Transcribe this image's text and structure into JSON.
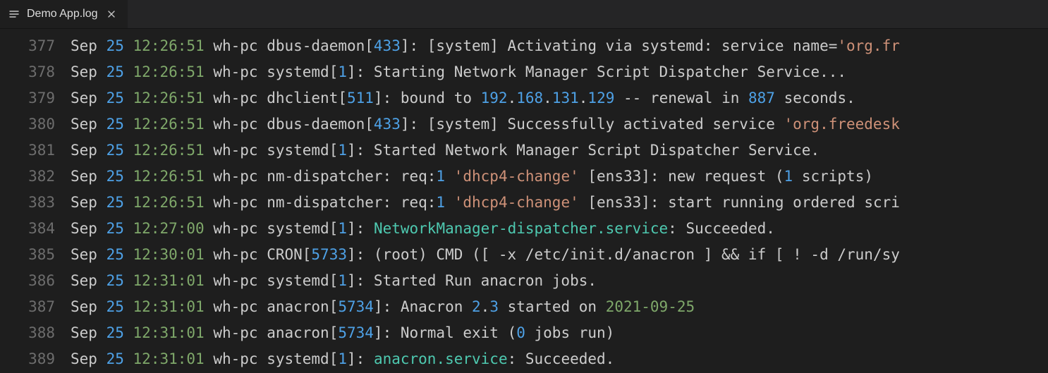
{
  "tab": {
    "title": "Demo App.log"
  },
  "lines": [
    {
      "no": 377,
      "tokens": [
        {
          "t": "Sep "
        },
        {
          "t": "25",
          "c": "blue"
        },
        {
          "t": " "
        },
        {
          "t": "12:26:51",
          "c": "green"
        },
        {
          "t": " wh-pc dbus-daemon["
        },
        {
          "t": "433",
          "c": "blue"
        },
        {
          "t": "]: [system] Activating via systemd: service name="
        },
        {
          "t": "'org.fr",
          "c": "orange"
        }
      ]
    },
    {
      "no": 378,
      "tokens": [
        {
          "t": "Sep "
        },
        {
          "t": "25",
          "c": "blue"
        },
        {
          "t": " "
        },
        {
          "t": "12:26:51",
          "c": "green"
        },
        {
          "t": " wh-pc systemd["
        },
        {
          "t": "1",
          "c": "blue"
        },
        {
          "t": "]: Starting Network Manager Script Dispatcher Service..."
        }
      ]
    },
    {
      "no": 379,
      "tokens": [
        {
          "t": "Sep "
        },
        {
          "t": "25",
          "c": "blue"
        },
        {
          "t": " "
        },
        {
          "t": "12:26:51",
          "c": "green"
        },
        {
          "t": " wh-pc dhclient["
        },
        {
          "t": "511",
          "c": "blue"
        },
        {
          "t": "]: bound to "
        },
        {
          "t": "192",
          "c": "blue"
        },
        {
          "t": "."
        },
        {
          "t": "168",
          "c": "blue"
        },
        {
          "t": "."
        },
        {
          "t": "131",
          "c": "blue"
        },
        {
          "t": "."
        },
        {
          "t": "129",
          "c": "blue"
        },
        {
          "t": " -- renewal in "
        },
        {
          "t": "887",
          "c": "blue"
        },
        {
          "t": " seconds."
        }
      ]
    },
    {
      "no": 380,
      "tokens": [
        {
          "t": "Sep "
        },
        {
          "t": "25",
          "c": "blue"
        },
        {
          "t": " "
        },
        {
          "t": "12:26:51",
          "c": "green"
        },
        {
          "t": " wh-pc dbus-daemon["
        },
        {
          "t": "433",
          "c": "blue"
        },
        {
          "t": "]: [system] Successfully activated service "
        },
        {
          "t": "'org.freedesk",
          "c": "orange"
        }
      ]
    },
    {
      "no": 381,
      "tokens": [
        {
          "t": "Sep "
        },
        {
          "t": "25",
          "c": "blue"
        },
        {
          "t": " "
        },
        {
          "t": "12:26:51",
          "c": "green"
        },
        {
          "t": " wh-pc systemd["
        },
        {
          "t": "1",
          "c": "blue"
        },
        {
          "t": "]: Started Network Manager Script Dispatcher Service."
        }
      ]
    },
    {
      "no": 382,
      "tokens": [
        {
          "t": "Sep "
        },
        {
          "t": "25",
          "c": "blue"
        },
        {
          "t": " "
        },
        {
          "t": "12:26:51",
          "c": "green"
        },
        {
          "t": " wh-pc nm-dispatcher: req:"
        },
        {
          "t": "1",
          "c": "blue"
        },
        {
          "t": " "
        },
        {
          "t": "'dhcp4-change'",
          "c": "orange"
        },
        {
          "t": " [ens33]: new request ("
        },
        {
          "t": "1",
          "c": "blue"
        },
        {
          "t": " scripts)"
        }
      ]
    },
    {
      "no": 383,
      "tokens": [
        {
          "t": "Sep "
        },
        {
          "t": "25",
          "c": "blue"
        },
        {
          "t": " "
        },
        {
          "t": "12:26:51",
          "c": "green"
        },
        {
          "t": " wh-pc nm-dispatcher: req:"
        },
        {
          "t": "1",
          "c": "blue"
        },
        {
          "t": " "
        },
        {
          "t": "'dhcp4-change'",
          "c": "orange"
        },
        {
          "t": " [ens33]: start running ordered scri"
        }
      ]
    },
    {
      "no": 384,
      "tokens": [
        {
          "t": "Sep "
        },
        {
          "t": "25",
          "c": "blue"
        },
        {
          "t": " "
        },
        {
          "t": "12:27:00",
          "c": "green"
        },
        {
          "t": " wh-pc systemd["
        },
        {
          "t": "1",
          "c": "blue"
        },
        {
          "t": "]: "
        },
        {
          "t": "NetworkManager-dispatcher.service",
          "c": "teal"
        },
        {
          "t": ": Succeeded."
        }
      ]
    },
    {
      "no": 385,
      "tokens": [
        {
          "t": "Sep "
        },
        {
          "t": "25",
          "c": "blue"
        },
        {
          "t": " "
        },
        {
          "t": "12:30:01",
          "c": "green"
        },
        {
          "t": " wh-pc CRON["
        },
        {
          "t": "5733",
          "c": "blue"
        },
        {
          "t": "]: (root) CMD ([ -x /etc/init.d/anacron ] && if [ ! -d /run/sy"
        }
      ]
    },
    {
      "no": 386,
      "tokens": [
        {
          "t": "Sep "
        },
        {
          "t": "25",
          "c": "blue"
        },
        {
          "t": " "
        },
        {
          "t": "12:31:01",
          "c": "green"
        },
        {
          "t": " wh-pc systemd["
        },
        {
          "t": "1",
          "c": "blue"
        },
        {
          "t": "]: Started Run anacron jobs."
        }
      ]
    },
    {
      "no": 387,
      "tokens": [
        {
          "t": "Sep "
        },
        {
          "t": "25",
          "c": "blue"
        },
        {
          "t": " "
        },
        {
          "t": "12:31:01",
          "c": "green"
        },
        {
          "t": " wh-pc anacron["
        },
        {
          "t": "5734",
          "c": "blue"
        },
        {
          "t": "]: Anacron "
        },
        {
          "t": "2",
          "c": "blue"
        },
        {
          "t": "."
        },
        {
          "t": "3",
          "c": "blue"
        },
        {
          "t": " started on "
        },
        {
          "t": "2021-09-25",
          "c": "green"
        }
      ]
    },
    {
      "no": 388,
      "tokens": [
        {
          "t": "Sep "
        },
        {
          "t": "25",
          "c": "blue"
        },
        {
          "t": " "
        },
        {
          "t": "12:31:01",
          "c": "green"
        },
        {
          "t": " wh-pc anacron["
        },
        {
          "t": "5734",
          "c": "blue"
        },
        {
          "t": "]: Normal exit ("
        },
        {
          "t": "0",
          "c": "blue"
        },
        {
          "t": " jobs run)"
        }
      ]
    },
    {
      "no": 389,
      "tokens": [
        {
          "t": "Sep "
        },
        {
          "t": "25",
          "c": "blue"
        },
        {
          "t": " "
        },
        {
          "t": "12:31:01",
          "c": "green"
        },
        {
          "t": " wh-pc systemd["
        },
        {
          "t": "1",
          "c": "blue"
        },
        {
          "t": "]: "
        },
        {
          "t": "anacron.service",
          "c": "teal"
        },
        {
          "t": ": Succeeded."
        }
      ]
    }
  ]
}
